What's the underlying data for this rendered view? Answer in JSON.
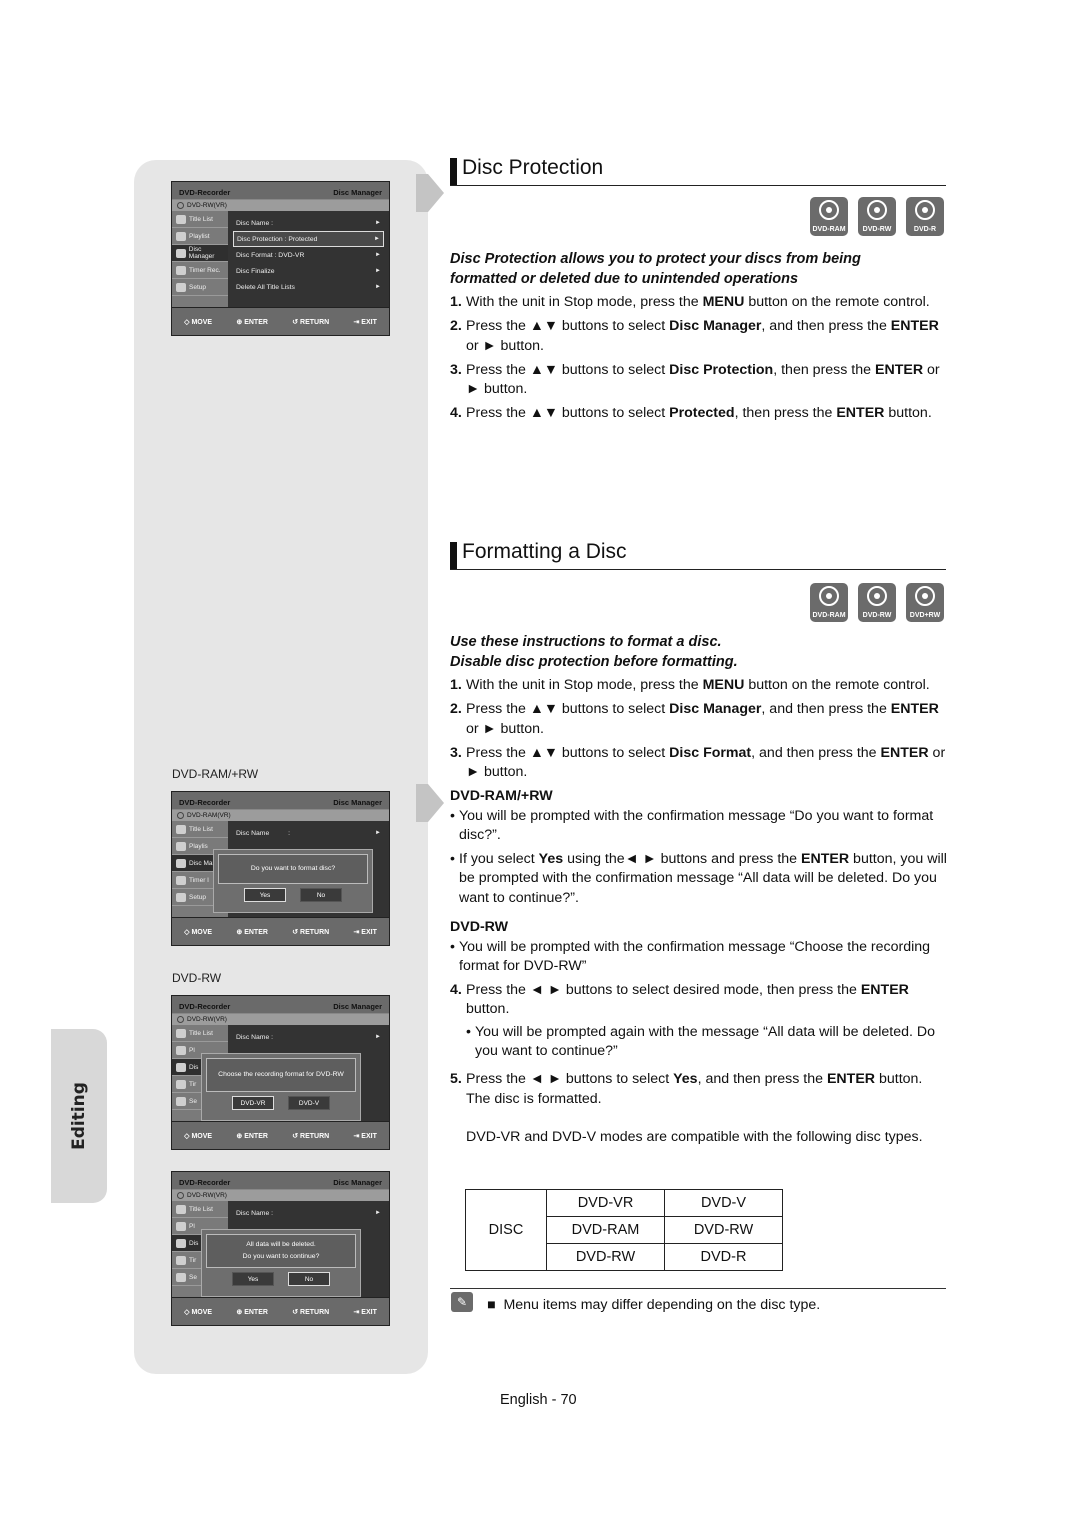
{
  "side_tab": {
    "label": "Editing"
  },
  "osd_common": {
    "app": "DVD-Recorder",
    "section": "Disc Manager",
    "sidebar": [
      "Title List",
      "Playlist",
      "Disc Manager",
      "Timer Rec.",
      "Setup"
    ],
    "footer": [
      "MOVE",
      "ENTER",
      "RETURN",
      "EXIT"
    ]
  },
  "screens": {
    "protection": {
      "disc": "DVD-RW(VR)",
      "menu": [
        "Disc Name :",
        "Disc Protection : Protected",
        "Disc Format : DVD-VR",
        "Disc Finalize",
        "Delete All Title Lists"
      ]
    },
    "format_ram": {
      "caption": "DVD-RAM/+RW",
      "disc": "DVD-RAM(VR)",
      "menu_first": "Disc Name",
      "menu_first_value": ":",
      "sidebar_trunc": [
        "Title List",
        "Playlis",
        "Disc Man",
        "Timer I",
        "Setup"
      ],
      "popup_msg": "Do you want to format disc?",
      "yes": "Yes",
      "no": "No"
    },
    "format_rw": {
      "caption": "DVD-RW",
      "disc": "DVD-RW(VR)",
      "menu_first": "Disc Name :",
      "sidebar_trunc": [
        "Title List",
        "Pl",
        "Dis",
        "Tir",
        "Se"
      ],
      "popup_msg": "Choose the recording format for DVD-RW",
      "opt1": "DVD-VR",
      "opt2": "DVD-V"
    },
    "format_confirm": {
      "disc": "DVD-RW(VR)",
      "menu_first": "Disc Name :",
      "sidebar_trunc": [
        "Title List",
        "Pl",
        "Dis",
        "Tir",
        "Se"
      ],
      "popup_line1": "All data will be deleted.",
      "popup_line2": "Do you want to continue?",
      "yes": "Yes",
      "no": "No"
    }
  },
  "disc_protection": {
    "title": "Disc Protection",
    "icons": [
      "DVD-RAM",
      "DVD-RW",
      "DVD-R"
    ],
    "intro": "Disc Protection allows you to protect your discs from being formatted or deleted due to unintended operations",
    "steps": [
      {
        "n": "1.",
        "pre": "With the unit in Stop mode, press the ",
        "b1": "MENU",
        "post": " button on the remote control."
      },
      {
        "n": "2.",
        "pre": "Press the ▲▼ buttons to select ",
        "b1": "Disc Manager",
        "mid": ", and then press the ",
        "b2": "ENTER",
        "post": " or ► button."
      },
      {
        "n": "3.",
        "pre": "Press the ▲▼ buttons to select ",
        "b1": "Disc Protection",
        "mid": ", then press the ",
        "b2": "ENTER",
        "post": " or ► button."
      },
      {
        "n": "4.",
        "pre": "Press the ▲▼ buttons to select ",
        "b1": "Protected",
        "mid": ", then press the ",
        "b2": "ENTER",
        "post": " button."
      }
    ]
  },
  "formatting": {
    "title": "Formatting a Disc",
    "icons": [
      "DVD-RAM",
      "DVD-RW",
      "DVD+RW"
    ],
    "intro1": "Use these instructions to format a disc.",
    "intro2": "Disable disc protection before formatting.",
    "steps": [
      {
        "n": "1.",
        "pre": "With the unit in Stop mode, press the ",
        "b1": "MENU",
        "post": " button on the remote control."
      },
      {
        "n": "2.",
        "pre": "Press the ▲▼ buttons to select ",
        "b1": "Disc Manager",
        "mid": ", and then press the ",
        "b2": "ENTER",
        "post": " or ► button."
      },
      {
        "n": "3.",
        "pre": "Press the ▲▼ buttons to select ",
        "b1": "Disc Format",
        "mid": ", and then press the ",
        "b2": "ENTER",
        "post": " or ► button."
      }
    ],
    "ram_heading": "DVD-RAM/+RW",
    "ram_bullet1": "You will be prompted with the confirmation message “Do you want to format disc?”.",
    "ram_bullet2_pre": "If you select ",
    "ram_bullet2_b1": "Yes",
    "ram_bullet2_mid": " using the◄ ► buttons and press the ",
    "ram_bullet2_b2": "ENTER",
    "ram_bullet2_post": " button, you will be prompted with the confirmation message “All data will be deleted. Do you want to continue?”.",
    "rw_heading": "DVD-RW",
    "rw_bullet": "You will be prompted with the confirmation message “Choose the recording format for DVD-RW”",
    "step4": {
      "n": "4.",
      "pre": "Press the ◄ ► buttons to select desired mode, then press the ",
      "b1": "ENTER",
      "post": " button."
    },
    "step4_bullet": "You will be prompted again with the message “All data will be deleted. Do you want to continue?”",
    "step5": {
      "n": "5.",
      "pre": "Press the ◄ ► buttons to select ",
      "b1": "Yes",
      "mid": ", and then press the ",
      "b2": "ENTER",
      "post": " button."
    },
    "formatted": "The disc is formatted.",
    "compat_text": "DVD-VR and DVD-V modes are compatible with the following disc types."
  },
  "compat_table": {
    "row_header": "DISC",
    "columns": [
      "DVD-VR",
      "DVD-V"
    ],
    "rows": [
      [
        "DVD-RAM",
        "DVD-RW"
      ],
      [
        "DVD-RW",
        "DVD-R"
      ]
    ]
  },
  "note": {
    "icon": "pencil-note-icon",
    "text": "Menu items may differ depending on the disc type."
  },
  "footer": {
    "page": "English - 70"
  }
}
